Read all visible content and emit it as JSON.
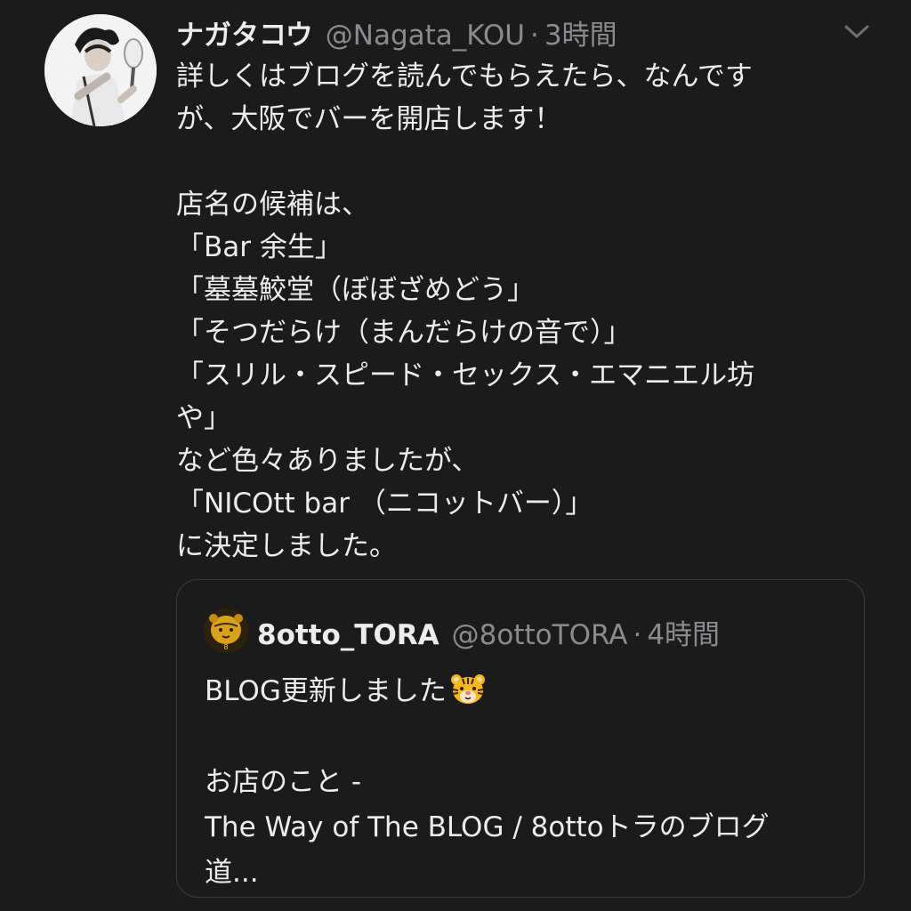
{
  "tweet": {
    "display_name": "ナガタコウ",
    "handle": "@Nagata_KOU",
    "separator": "·",
    "time": "3時間",
    "text_lines": [
      "詳しくはブログを読んでもらえたら、なんです",
      "が、大阪でバーを開店します！",
      "",
      "店名の候補は、",
      "「Bar 余生」",
      "「墓墓鮫堂（ぼぼざめどう」",
      "「そつだらけ（まんだらけの音で）」",
      "「スリル・スピード・セックス・エマニエル坊",
      "や」",
      "など色々ありましたが、",
      "「NICOtt bar （ニコットバー）」",
      "に決定しました。"
    ]
  },
  "quote": {
    "display_name": "8otto_TORA",
    "handle": "@8ottoTORA",
    "separator": "·",
    "time": "4時間",
    "line1": "BLOG更新しました",
    "blank1": "",
    "line2": "お店のこと -",
    "line3": "The Way of The BLOG / 8ottoトラのブログ",
    "line4": "道..."
  },
  "icons": {
    "menu": "chevron-down-icon",
    "emoji": "tiger-face-emoji"
  },
  "colors": {
    "background": "#1b1b1c",
    "primary_text": "#ececee",
    "secondary_text": "#8b8b8f",
    "card_border": "#3b3b3f"
  }
}
